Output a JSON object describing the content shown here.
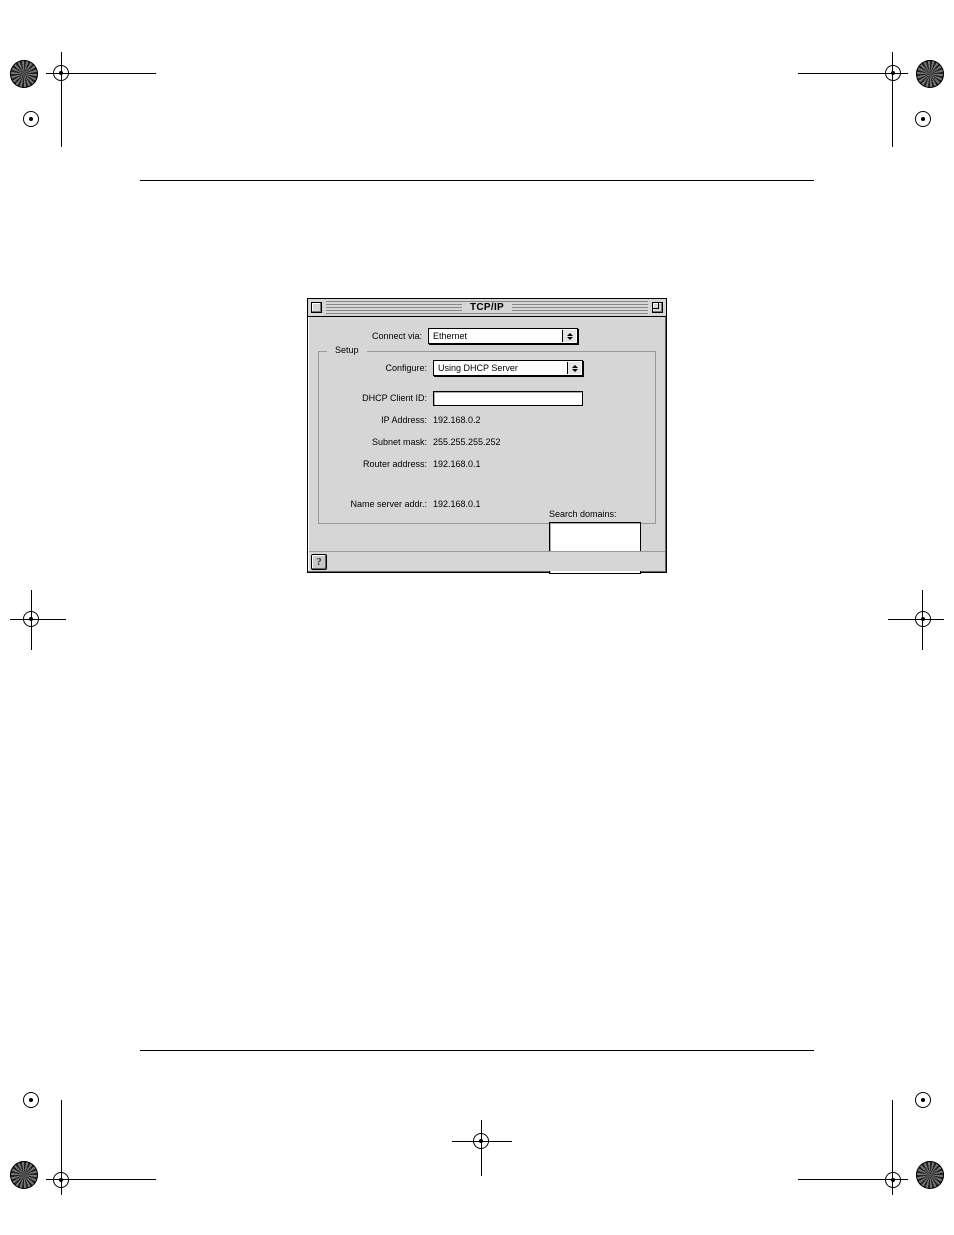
{
  "window": {
    "title": "TCP/IP",
    "connect_via_label": "Connect via:",
    "connect_via_value": "Ethernet",
    "groupbox_legend": "Setup",
    "configure_label": "Configure:",
    "configure_value": "Using DHCP Server",
    "dhcp_client_id_label": "DHCP Client ID:",
    "dhcp_client_id_value": "",
    "ip_address_label": "IP Address:",
    "ip_address_value": "192.168.0.2",
    "subnet_mask_label": "Subnet mask:",
    "subnet_mask_value": "255.255.255.252",
    "router_address_label": "Router address:",
    "router_address_value": "192.168.0.1",
    "name_server_label": "Name server addr.:",
    "name_server_value": "192.168.0.1",
    "search_domains_label": "Search domains:",
    "help_glyph": "?"
  }
}
